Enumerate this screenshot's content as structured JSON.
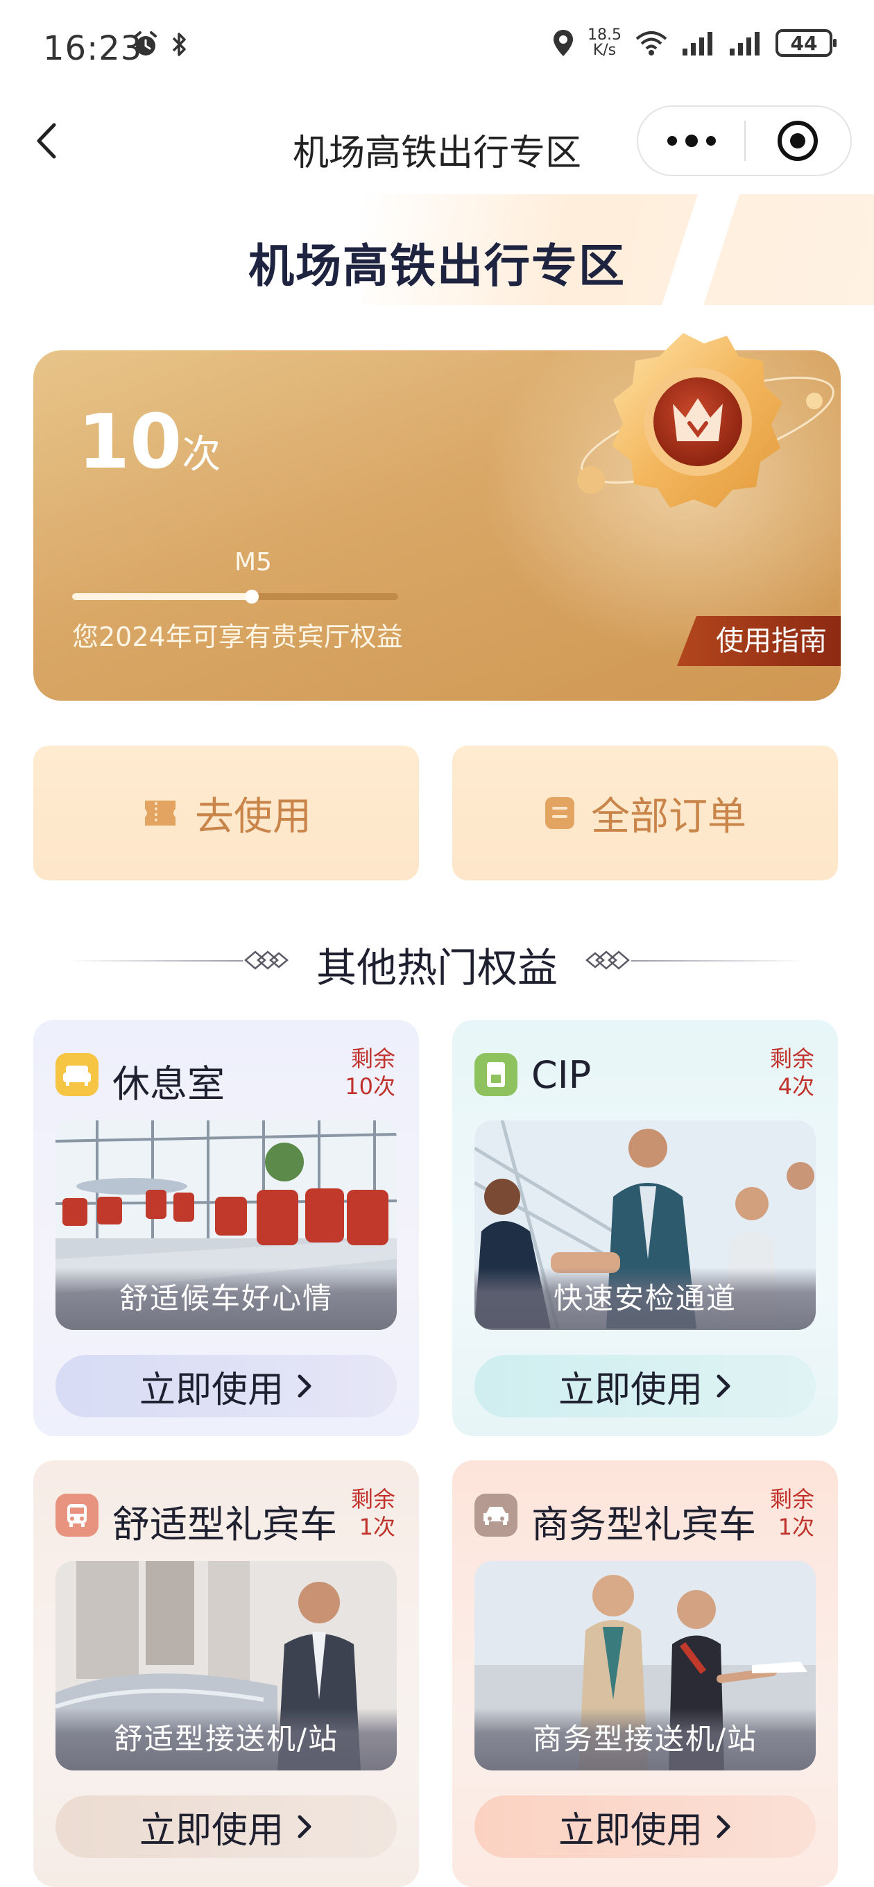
{
  "status_bar": {
    "time": "16:23",
    "net_speed_value": "18.5",
    "net_speed_unit": "K/s",
    "battery": "44"
  },
  "nav": {
    "title": "机场高铁出行专区"
  },
  "header": {
    "title": "机场高铁出行专区"
  },
  "membership_card": {
    "count": "10",
    "count_unit": "次",
    "level": "M5",
    "progress": 0.55,
    "description": "您2024年可享有贵宾厅权益",
    "guide_label": "使用指南"
  },
  "actions": {
    "use_label": "去使用",
    "orders_label": "全部订单"
  },
  "section": {
    "title": "其他热门权益"
  },
  "benefits": [
    {
      "title": "休息室",
      "remain_label": "剩余",
      "remain_count": "10次",
      "caption": "舒适候车好心情",
      "button": "立即使用",
      "icon": "sofa-icon",
      "icon_color": "#f6c544"
    },
    {
      "title": "CIP",
      "remain_label": "剩余",
      "remain_count": "4次",
      "caption": "快速安检通道",
      "button": "立即使用",
      "icon": "document-icon",
      "icon_color": "#8dc25f"
    },
    {
      "title": "舒适型礼宾车",
      "remain_label": "剩余",
      "remain_count": "1次",
      "caption": "舒适型接送机/站",
      "button": "立即使用",
      "icon": "bus-icon",
      "icon_color": "#e8937f"
    },
    {
      "title": "商务型礼宾车",
      "remain_label": "剩余",
      "remain_count": "1次",
      "caption": "商务型接送机/站",
      "button": "立即使用",
      "icon": "car-icon",
      "icon_color": "#b59a92"
    }
  ],
  "colors": {
    "accent_gold": "#d9a766",
    "remain_red": "#c0322b",
    "action_text": "#c9844a"
  }
}
